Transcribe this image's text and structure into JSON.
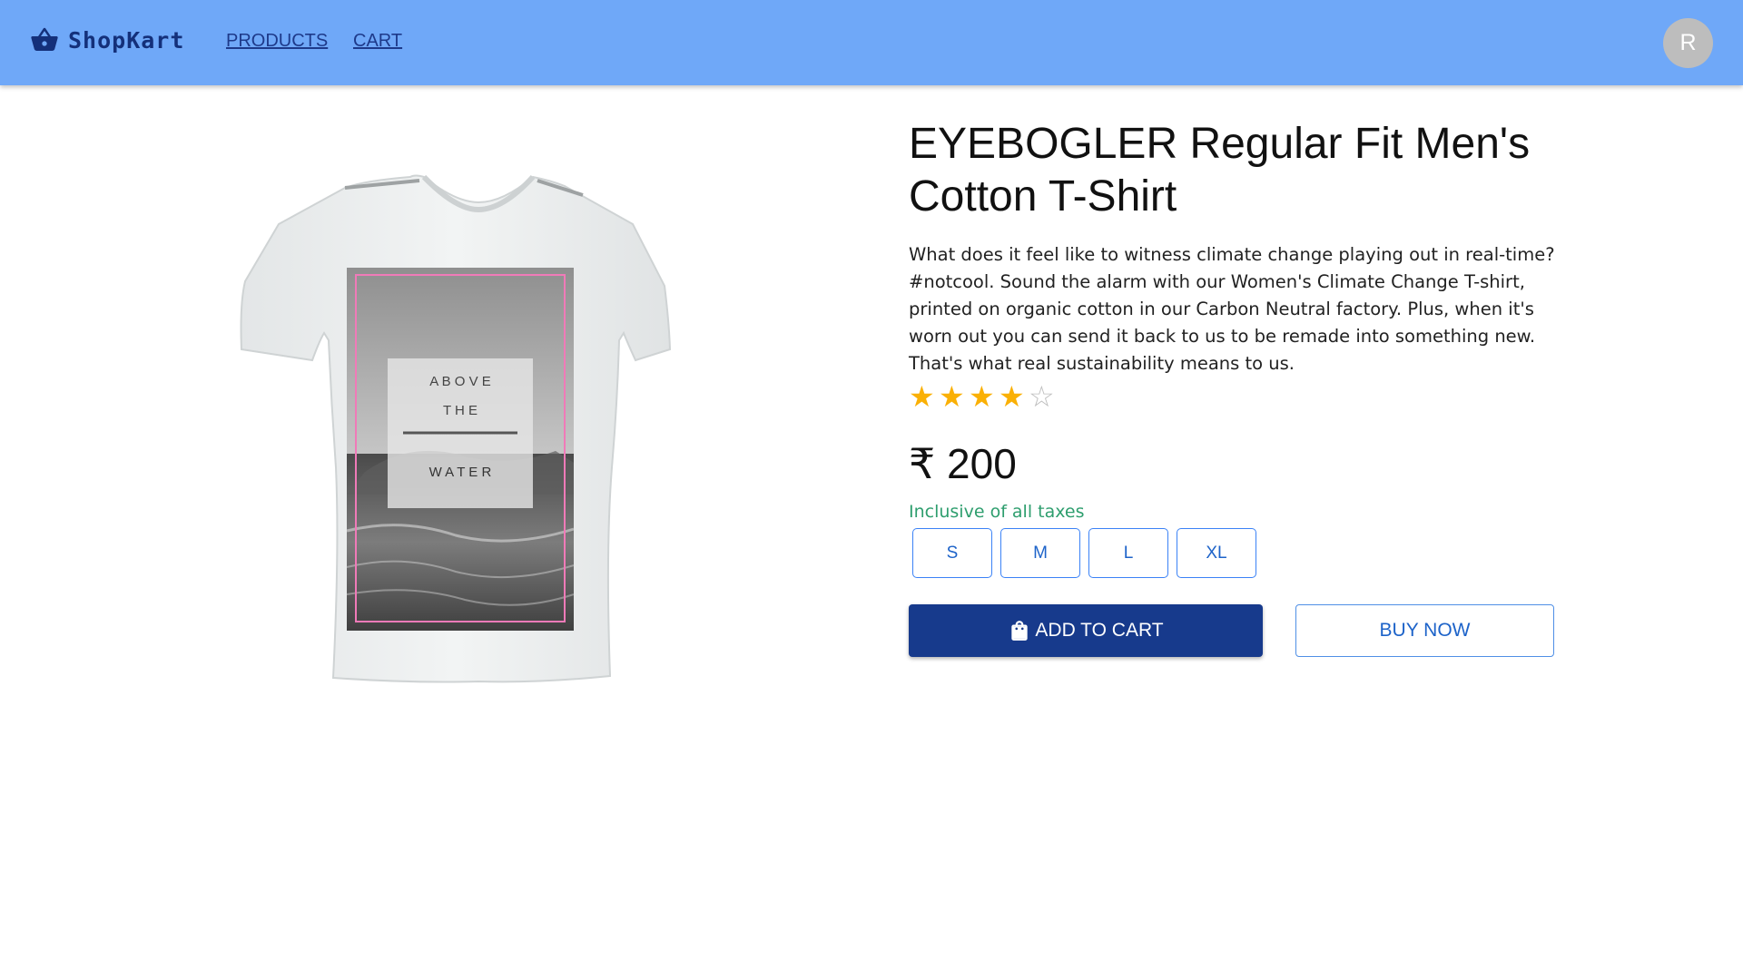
{
  "header": {
    "brand_name": "ShopKart",
    "nav_products": "PRODUCTS",
    "nav_cart": "CART",
    "avatar_initial": "R",
    "bar_color": "#6fa8f8",
    "brand_color": "#14307a"
  },
  "product": {
    "title": "EYEBOGLER Regular Fit Men's Cotton T-Shirt",
    "description": "What does it feel like to witness climate change playing out in real-time? #notcool. Sound the alarm with our Women's Climate Change T-shirt, printed on organic cotton in our Carbon Neutral factory. Plus, when it's worn out you can send it back to us to be remade into something new. That's what real sustainability means to us.",
    "rating": 4,
    "rating_max": 5,
    "price": "₹ 200",
    "tax_note": "Inclusive of all taxes",
    "print_text": [
      "A B O V E",
      "T H E",
      "W A T E R"
    ],
    "sizes": [
      "S",
      "M",
      "L",
      "XL"
    ]
  },
  "actions": {
    "add_to_cart": "ADD TO CART",
    "buy_now": "BUY NOW",
    "primary_color": "#173a8c"
  },
  "icons": {
    "brand": "shopping-basket-icon",
    "add_to_cart": "shopping-bag-icon",
    "star_full": "star-icon",
    "star_empty": "star-outline-icon"
  }
}
